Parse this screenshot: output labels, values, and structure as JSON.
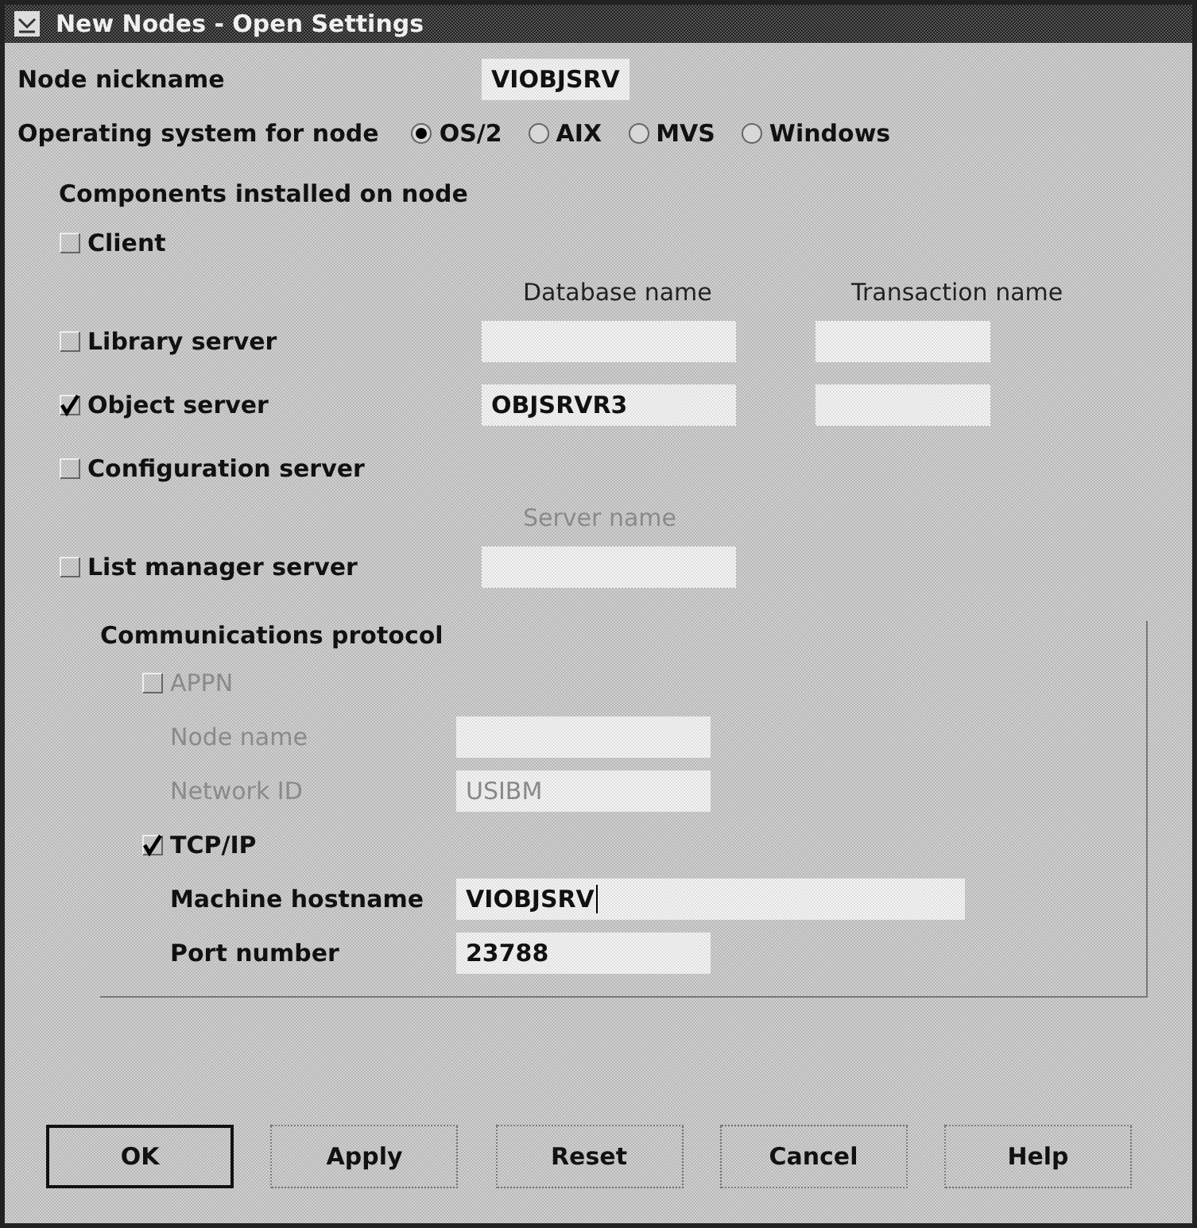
{
  "window": {
    "title": "New Nodes - Open Settings"
  },
  "nickname": {
    "label": "Node nickname",
    "value": "VIOBJSRV"
  },
  "operating_system": {
    "label": "Operating system for node",
    "options": [
      {
        "label": "OS/2",
        "selected": true
      },
      {
        "label": "AIX",
        "selected": false
      },
      {
        "label": "MVS",
        "selected": false
      },
      {
        "label": "Windows",
        "selected": false
      }
    ]
  },
  "components": {
    "title": "Components installed on node",
    "column_headers": [
      "Database name",
      "Transaction name"
    ],
    "rows": [
      {
        "kind": "plain",
        "label": "Client",
        "checked": false
      },
      {
        "kind": "headers"
      },
      {
        "kind": "two_fields",
        "label": "Library server",
        "checked": false,
        "database": {},
        "transaction": {}
      },
      {
        "kind": "two_fields",
        "label": "Object server",
        "checked": true,
        "database": {
          "value": "OBJSRVR3"
        },
        "transaction": {}
      },
      {
        "kind": "plain",
        "label": "Configuration server",
        "checked": false
      },
      {
        "kind": "caption",
        "text": "Server name"
      },
      {
        "kind": "one_field",
        "label": "List manager server",
        "checked": false,
        "field": {}
      }
    ]
  },
  "protocol": {
    "title": "Communications protocol",
    "items": [
      {
        "kind": "check",
        "label": "APPN",
        "checked": false,
        "disabled": true
      },
      {
        "kind": "field",
        "label": "Node name",
        "disabled": true
      },
      {
        "kind": "field",
        "label": "Network ID",
        "disabled": true,
        "value": "USIBM"
      },
      {
        "kind": "check",
        "label": "TCP/IP",
        "checked": true,
        "disabled": false
      },
      {
        "kind": "field",
        "label": "Machine hostname",
        "disabled": false,
        "value": "VIOBJSRV",
        "wide": true,
        "focused": true
      },
      {
        "kind": "field",
        "label": "Port number",
        "disabled": false,
        "value": "23788"
      }
    ]
  },
  "buttons": [
    {
      "label": "OK",
      "default": true
    },
    {
      "label": "Apply",
      "default": false
    },
    {
      "label": "Reset",
      "default": false
    },
    {
      "label": "Cancel",
      "default": false
    },
    {
      "label": "Help",
      "default": false
    }
  ]
}
